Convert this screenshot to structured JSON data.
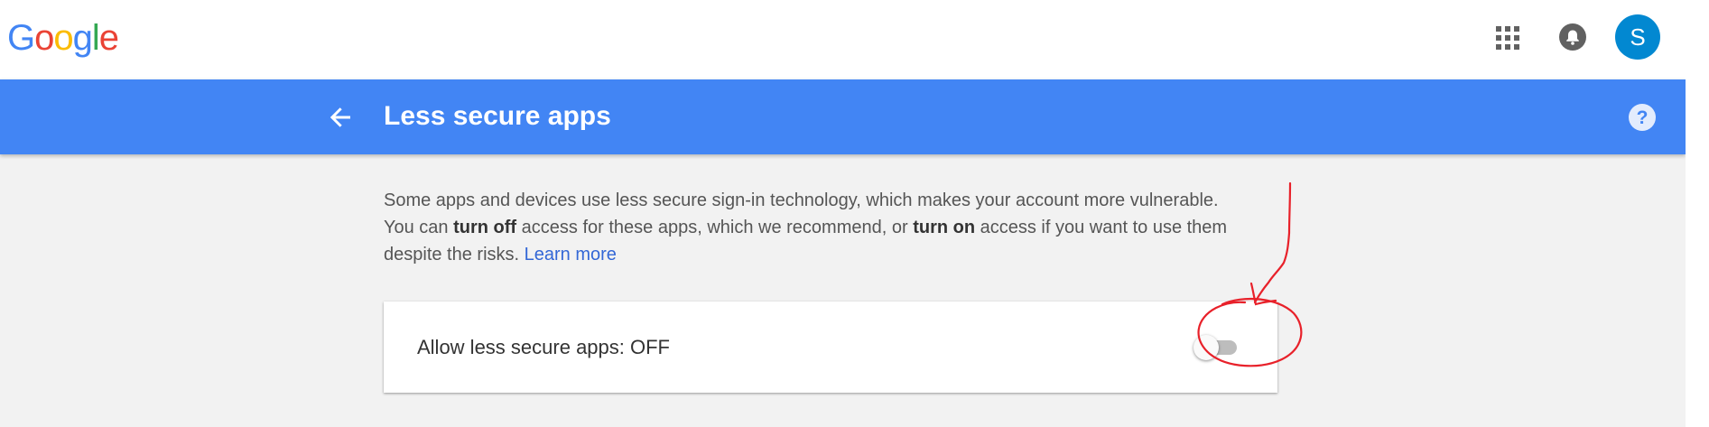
{
  "header": {
    "logo_letters": [
      "G",
      "o",
      "o",
      "g",
      "l",
      "e"
    ],
    "logo_colors": [
      "#4285f4",
      "#ea4335",
      "#fbbc05",
      "#4285f4",
      "#34a853",
      "#ea4335"
    ],
    "apps_icon": "apps-grid-icon",
    "notifications_icon": "bell-icon",
    "avatar_letter": "S",
    "avatar_color": "#0288d1"
  },
  "banner": {
    "back_icon": "arrow-back-icon",
    "title": "Less secure apps",
    "help_icon": "help-icon",
    "background": "#4285f4"
  },
  "description": {
    "line1": "Some apps and devices use less secure sign-in technology, which makes your account more vulnerable.",
    "part_you_can": "You can ",
    "turn_off": "turn off",
    "part_middle": " access for these apps, which we recommend, or ",
    "turn_on": "turn on",
    "part_end": " access if you want to use them despite the risks. ",
    "learn_more": "Learn more"
  },
  "setting": {
    "label": "Allow less secure apps: OFF",
    "toggle_on": false
  },
  "annotation": {
    "color": "#e8212a",
    "shapes": [
      "hand-drawn-arrow",
      "hand-drawn-circle"
    ]
  }
}
